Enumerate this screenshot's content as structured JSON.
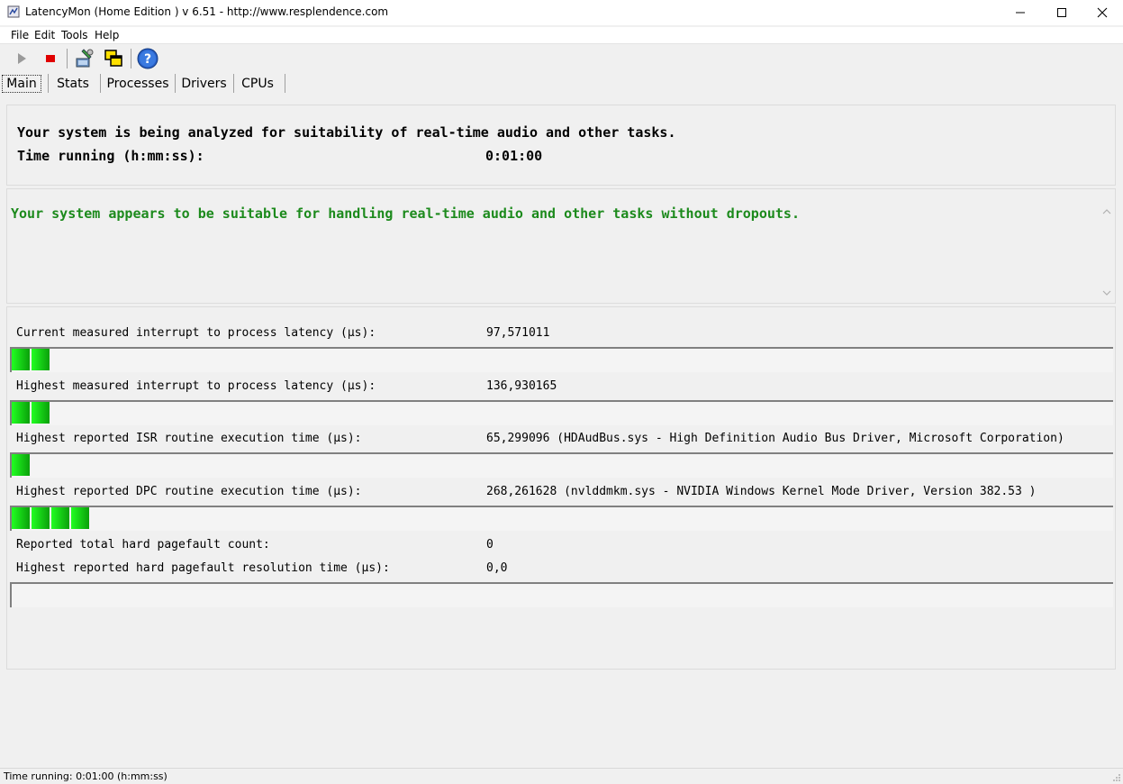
{
  "window": {
    "title": "LatencyMon  (Home Edition )  v 6.51 - http://www.resplendence.com"
  },
  "menu": [
    "File",
    "Edit",
    "Tools",
    "Help"
  ],
  "toolbar": {
    "icons": [
      "play-icon",
      "stop-icon",
      "tools-icon",
      "windows-icon",
      "help-icon"
    ]
  },
  "tabs": [
    "Main",
    "Stats",
    "Processes",
    "Drivers",
    "CPUs"
  ],
  "summary": {
    "analyzing": "Your system is being analyzed for suitability of real-time audio and other tasks.",
    "time_label": "Time running (h:mm:ss):",
    "time_value": "0:01:00",
    "verdict": "Your system appears to be suitable for handling real-time audio and other tasks without dropouts."
  },
  "metrics": [
    {
      "label": "Current measured interrupt to process latency (µs):",
      "value": "97,571011",
      "bar_segments": 2
    },
    {
      "label": "Highest measured interrupt to process latency (µs):",
      "value": "136,930165",
      "bar_segments": 2
    },
    {
      "label": "Highest reported ISR routine execution time (µs):",
      "value": "65,299096  (HDAudBus.sys - High Definition Audio Bus Driver, Microsoft Corporation)",
      "bar_segments": 1
    },
    {
      "label": "Highest reported DPC routine execution time (µs):",
      "value": "268,261628  (nvlddmkm.sys - NVIDIA Windows Kernel Mode Driver, Version 382.53 )",
      "bar_segments": 4
    }
  ],
  "pagefault": {
    "count_label": "Reported total hard pagefault count:",
    "count_value": "0",
    "time_label": "Highest reported hard pagefault resolution time (µs):",
    "time_value": "0,0",
    "bar_segments": 0
  },
  "statusbar": {
    "text": "Time running: 0:01:00  (h:mm:ss)"
  },
  "colors": {
    "verdict_green": "#1c8a1c",
    "bar_green": "#22ff22"
  }
}
